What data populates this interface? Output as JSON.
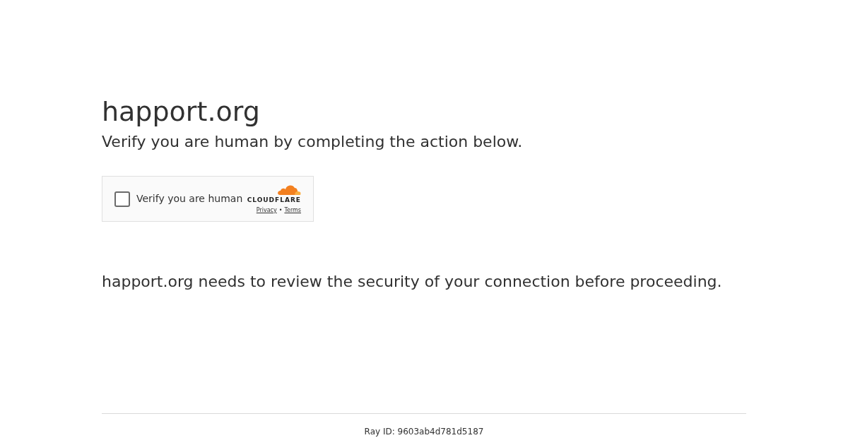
{
  "title": "happort.org",
  "subtitle": "Verify you are human by completing the action below.",
  "widget": {
    "checkbox": {
      "label": "Verify you are human",
      "checked": false
    },
    "brand": "CLOUDFLARE",
    "links": [
      "Privacy",
      "Terms"
    ],
    "separator": "•"
  },
  "message": "happort.org needs to review the security of your connection before proceeding.",
  "footer": {
    "ray_id": "Ray ID: 9603ab4d781d5187"
  }
}
